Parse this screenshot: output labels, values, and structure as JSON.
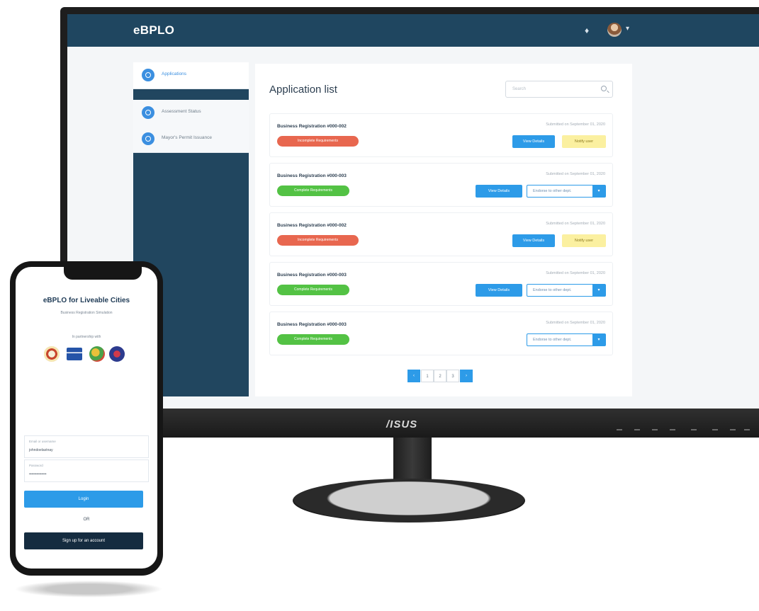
{
  "desktop": {
    "brand": "eBPLO",
    "sidebar": {
      "items": [
        {
          "label": "Applications",
          "active": true
        },
        {
          "label": "Assessment Status",
          "active": false
        },
        {
          "label": "Mayor's Permit Issuance",
          "active": false
        }
      ]
    },
    "main": {
      "title": "Application list",
      "search_placeholder": "Search"
    },
    "applications": [
      {
        "title": "Business Registration #000-002",
        "date": "Submitted on September 01, 2020",
        "status": "Incomplete Requirements",
        "status_color": "#e8674f",
        "view_label": "View Details",
        "action_label": "Notify user"
      },
      {
        "title": "Business Registration #000-003",
        "date": "Submitted on September 01, 2020",
        "status": "Complete Requirements",
        "status_color": "#53c244",
        "view_label": "View Details",
        "dropdown_label": "Endorse to other dept."
      },
      {
        "title": "Business Registration #000-002",
        "date": "Submitted on September 01, 2020",
        "status": "Incomplete Requirements",
        "status_color": "#e8674f",
        "view_label": "View Details",
        "action_label": "Notify user"
      },
      {
        "title": "Business Registration #000-003",
        "date": "Submitted on September 01, 2020",
        "status": "Complete Requirements",
        "status_color": "#53c244",
        "view_label": "View Details",
        "dropdown_label": "Endorse to other dept."
      },
      {
        "title": "Business Registration #000-003",
        "date": "Submitted on September 01, 2020",
        "status": "Complete Requirements",
        "status_color": "#53c244",
        "dropdown_label": "Endorse to other dept."
      }
    ],
    "pagination": {
      "prev": "‹",
      "pages": [
        "1",
        "2",
        "3"
      ],
      "next": "›"
    }
  },
  "monitor": {
    "logo": "/ISUS"
  },
  "phone": {
    "title": "eBPLO for Liveable Cities",
    "subtitle": "Business Registration Simulation",
    "partnership": "In partnership with",
    "username_label": "Email or username",
    "username_value": "johndoelastnay",
    "password_label": "Password",
    "password_value": "••••••••••••••",
    "login_label": "Login",
    "or_label": "OR",
    "signup_label": "Sign up for an account"
  },
  "colors": {
    "nav": "#1f4660",
    "accent": "#2d9be8",
    "incomplete": "#e8674f",
    "complete": "#53c244",
    "notify": "#fbf0a0"
  },
  "icons": [
    "bell-icon",
    "user-avatar",
    "chevron-down-icon",
    "search-icon",
    "chevron-left-icon",
    "chevron-right-icon"
  ]
}
